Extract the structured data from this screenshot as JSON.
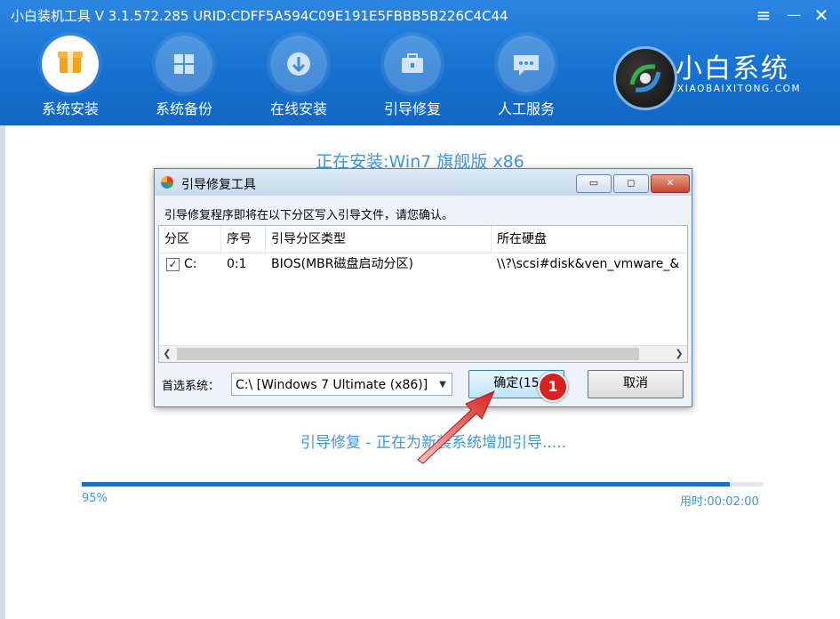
{
  "app": {
    "title": "小白装机工具 V 3.1.572.285 URID:CDFF5A594C09E191E5FBBB5B226C4C44",
    "menu_icon": "≡",
    "minimize_icon": "—",
    "close_icon": "✕"
  },
  "nav": [
    {
      "label": "系统安装",
      "icon": "box-icon",
      "active": true
    },
    {
      "label": "系统备份",
      "icon": "windows-icon",
      "active": false
    },
    {
      "label": "在线安装",
      "icon": "download-icon",
      "active": false
    },
    {
      "label": "引导修复",
      "icon": "toolbox-icon",
      "active": false
    },
    {
      "label": "人工服务",
      "icon": "chat-icon",
      "active": false
    }
  ],
  "brand": {
    "name": "小白系统",
    "domain": "XIAOBAIXITONG.COM"
  },
  "status": {
    "installing": "正在安装:Win7 旗舰版 x86",
    "repairing": "引导修复 - 正在为新装系统增加引导.....",
    "progress_percent": 95,
    "progress_text": "95%",
    "elapsed": "用时:00:02:00"
  },
  "dialog": {
    "title": "引导修复工具",
    "message": "引导修复程序即将在以下分区写入引导文件，请您确认。",
    "columns": [
      "分区",
      "序号",
      "引导分区类型",
      "所在硬盘"
    ],
    "rows": [
      {
        "checked": true,
        "partition": "C:",
        "index": "0:1",
        "type": "BIOS(MBR磁盘启动分区)",
        "disk": "\\\\?\\scsi#disk&ven_vmware_&"
      }
    ],
    "preferred_label": "首选系统：",
    "preferred_value": "C:\\ [Windows 7 Ultimate (x86)]",
    "ok_label": "确定(15",
    "cancel_label": "取消",
    "btn_min": "▭",
    "btn_max": "◻",
    "btn_close": "✕"
  },
  "annotation": {
    "badge": "1"
  },
  "colors": {
    "topbar": "#1570cf",
    "accent_text": "#3a97e6",
    "progress": "#1a6fd0",
    "badge": "#d8221f"
  }
}
